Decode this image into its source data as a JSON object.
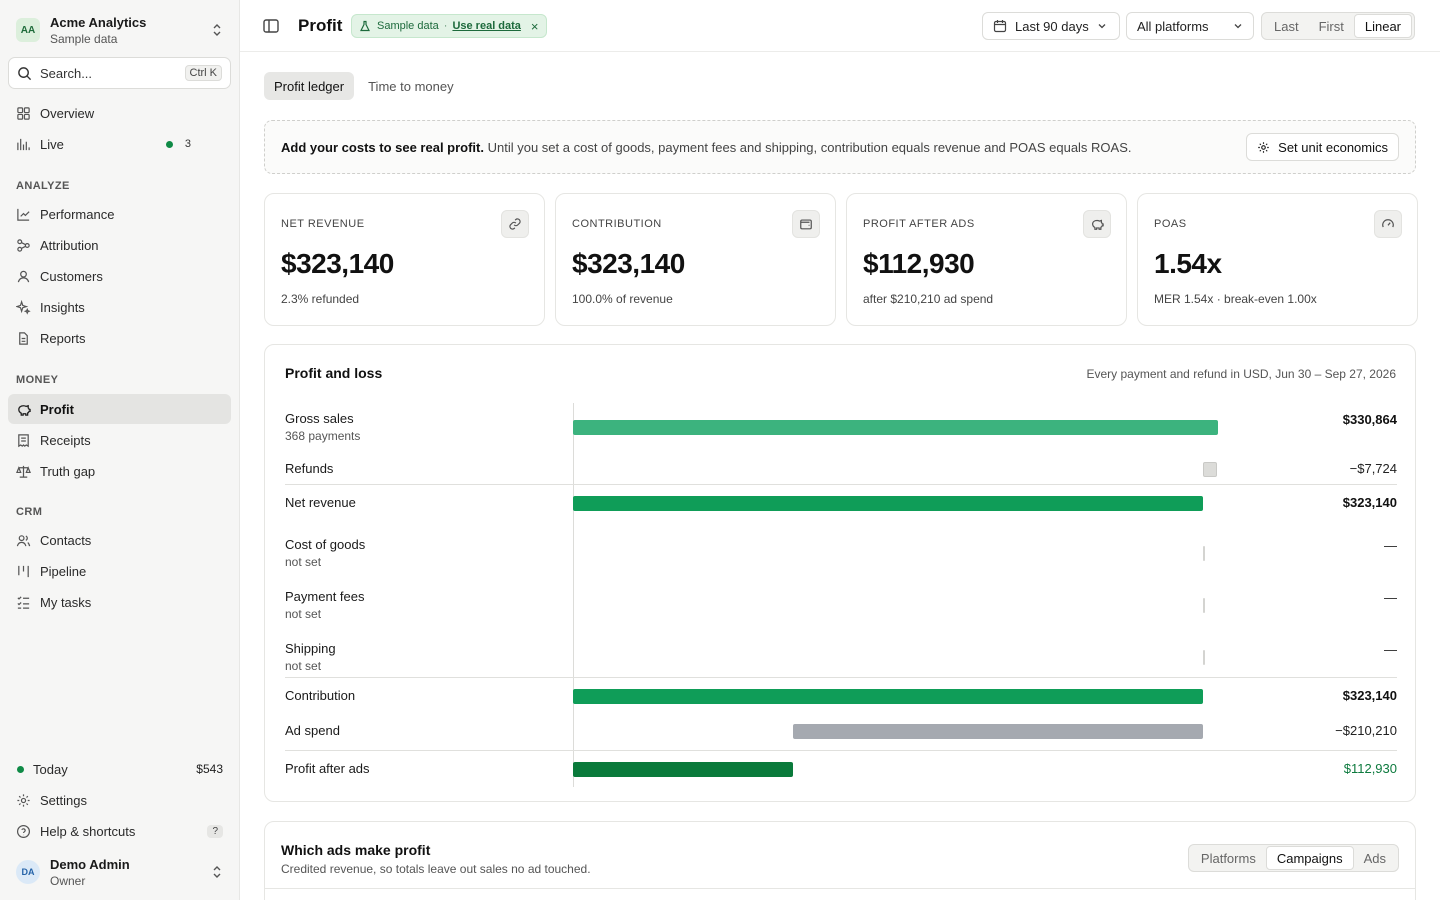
{
  "workspace": {
    "initials": "AA",
    "name": "Acme Analytics",
    "subtitle": "Sample data"
  },
  "search": {
    "placeholder": "Search...",
    "shortcut": "Ctrl K"
  },
  "nav": {
    "overview": "Overview",
    "live": "Live",
    "live_count": "3",
    "section_analyze": "ANALYZE",
    "performance": "Performance",
    "attribution": "Attribution",
    "customers": "Customers",
    "insights": "Insights",
    "reports": "Reports",
    "section_money": "MONEY",
    "profit": "Profit",
    "receipts": "Receipts",
    "truth_gap": "Truth gap",
    "section_crm": "CRM",
    "contacts": "Contacts",
    "pipeline": "Pipeline",
    "my_tasks": "My tasks"
  },
  "footer": {
    "today_label": "Today",
    "today_value": "$543",
    "settings": "Settings",
    "help": "Help & shortcuts",
    "help_key": "?"
  },
  "user": {
    "initials": "DA",
    "name": "Demo Admin",
    "role": "Owner"
  },
  "header": {
    "title": "Profit",
    "sample_label": "Sample data",
    "sample_sep": "·",
    "sample_link": "Use real data",
    "sample_close": "×",
    "date_range": "Last 90 days",
    "platform": "All platforms",
    "attribution_models": [
      "Last",
      "First",
      "Linear"
    ],
    "attribution_active": "Linear"
  },
  "tabs": [
    "Profit ledger",
    "Time to money"
  ],
  "tabs_active": "Profit ledger",
  "notice": {
    "bold": "Add your costs to see real profit.",
    "text": " Until you set a cost of goods, payment fees and shipping, contribution equals revenue and POAS equals ROAS.",
    "button": "Set unit economics"
  },
  "kpis": [
    {
      "label": "NET REVENUE",
      "value": "$323,140",
      "sub": "2.3% refunded",
      "icon": "link-icon"
    },
    {
      "label": "CONTRIBUTION",
      "value": "$323,140",
      "sub": "100.0% of revenue",
      "icon": "wallet-icon"
    },
    {
      "label": "PROFIT AFTER ADS",
      "value": "$112,930",
      "sub": "after $210,210 ad spend",
      "icon": "piggy-bank-icon"
    },
    {
      "label": "POAS",
      "value": "1.54x",
      "sub": "MER 1.54x · break-even 1.00x",
      "icon": "gauge-icon"
    }
  ],
  "pl": {
    "title": "Profit and loss",
    "meta": "Every payment and refund in USD, Jun 30 – Sep 27, 2026",
    "rows": [
      {
        "label": "Gross sales",
        "sub": "368 payments",
        "value": "$330,864",
        "amount": 330864
      },
      {
        "label": "Refunds",
        "sub": "",
        "value": "−$7,724",
        "amount": -7724
      },
      {
        "label": "Net revenue",
        "sub": "",
        "value": "$323,140",
        "amount": 323140
      },
      {
        "label": "Cost of goods",
        "sub": "not set",
        "value": "—",
        "amount": 0
      },
      {
        "label": "Payment fees",
        "sub": "not set",
        "value": "—",
        "amount": 0
      },
      {
        "label": "Shipping",
        "sub": "not set",
        "value": "—",
        "amount": 0
      },
      {
        "label": "Contribution",
        "sub": "",
        "value": "$323,140",
        "amount": 323140
      },
      {
        "label": "Ad spend",
        "sub": "",
        "value": "−$210,210",
        "amount": -210210
      },
      {
        "label": "Profit after ads",
        "sub": "",
        "value": "$112,930",
        "amount": 112930
      }
    ]
  },
  "ads": {
    "title": "Which ads make profit",
    "subtitle": "Credited revenue, so totals leave out sales no ad touched.",
    "views": [
      "Platforms",
      "Campaigns",
      "Ads"
    ],
    "active_view": "Campaigns"
  },
  "colors": {
    "accent_green": "#0f9d58",
    "gross_green": "#3cb37e",
    "dark_green": "#0a7a3b",
    "ad_spend_gray": "#a5a9b0"
  }
}
